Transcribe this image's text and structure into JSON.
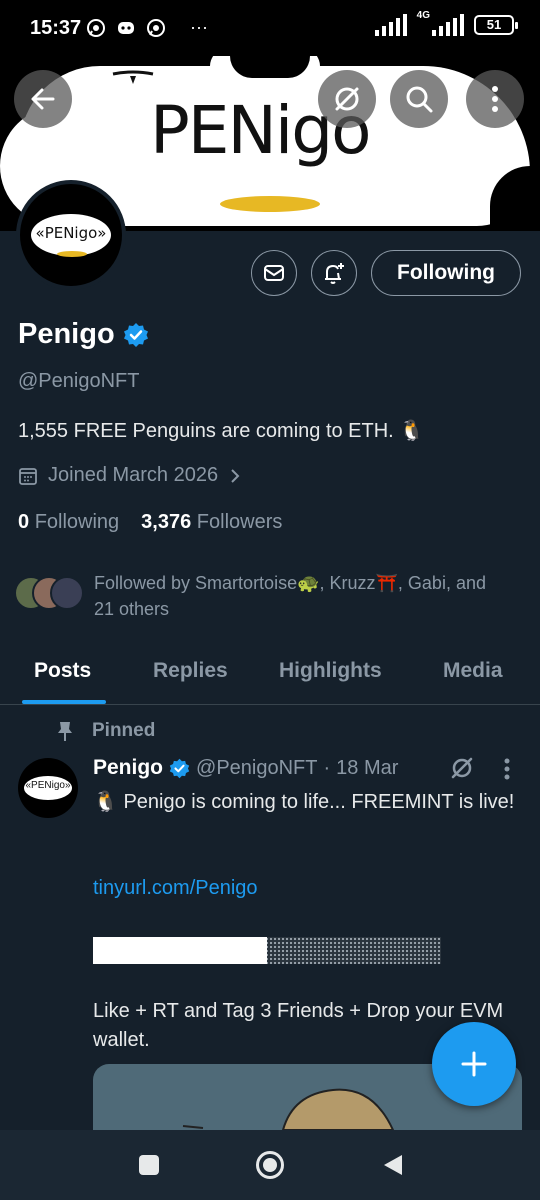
{
  "status_bar": {
    "time": "15:37",
    "left_icons": [
      "whatsapp-icon",
      "discord-icon",
      "whatsapp-icon"
    ],
    "more": "···",
    "network": "4G",
    "battery": "51"
  },
  "banner": {
    "title": "PENigo",
    "buttons": [
      "back-arrow-icon",
      "grok-icon",
      "search-icon",
      "more-vertical-icon"
    ]
  },
  "avatar": {
    "text": "«PENigo»"
  },
  "actions": {
    "message_icon": "mail-icon",
    "notify_icon": "bell-plus-icon",
    "following_label": "Following"
  },
  "profile": {
    "name": "Penigo",
    "handle": "@PenigoNFT",
    "bio": "1,555 FREE Penguins are coming to ETH.  🐧",
    "joined": "Joined March 2026",
    "following_count": "0",
    "following_label": "Following",
    "followers_count": "3,376",
    "followers_label": "Followers",
    "followed_by": "Followed by Smartortoise🐢, Kruzz⛩️, Gabi, and 21 others",
    "verified_color": "#1d9bf0"
  },
  "tabs": [
    {
      "label": "Posts",
      "active": true
    },
    {
      "label": "Replies",
      "active": false
    },
    {
      "label": "Highlights",
      "active": false
    },
    {
      "label": "Media",
      "active": false
    }
  ],
  "pinned_post": {
    "pinned_label": "Pinned",
    "author_name": "Penigo",
    "author_handle": "@PenigoNFT",
    "separator": "·",
    "date": "18 Mar",
    "avatar_text": "«PENigo»",
    "text1": "🐧 Penigo is coming to life... FREEMINT is live!",
    "link": "tinyurl.com/Penigo",
    "progress_fraction": 0.5,
    "text2": "Like + RT and Tag 3 Friends + Drop your EVM wallet."
  },
  "fab": {
    "icon": "plus-icon"
  },
  "nav_bar": {
    "buttons": [
      "recents-square-icon",
      "home-circle-icon",
      "back-triangle-icon"
    ]
  },
  "colors": {
    "accent": "#1d9bf0",
    "background": "#15202b",
    "muted": "#8b98a5"
  }
}
